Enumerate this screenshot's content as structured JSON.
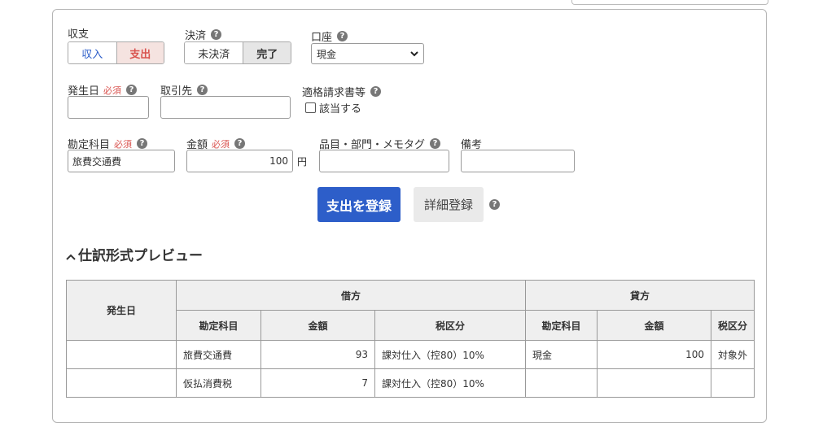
{
  "form": {
    "income_expense": {
      "label": "収支",
      "options": [
        "収入",
        "支出"
      ],
      "selected": "支出"
    },
    "settlement": {
      "label": "決済",
      "options": [
        "未決済",
        "完了"
      ],
      "selected": "完了"
    },
    "account": {
      "label": "口座",
      "value": "現金"
    },
    "date": {
      "label": "発生日",
      "required": "必須",
      "value": ""
    },
    "partner": {
      "label": "取引先",
      "value": ""
    },
    "invoice": {
      "label": "適格請求書等",
      "checkbox_label": "該当する",
      "checked": false
    },
    "category": {
      "label": "勘定科目",
      "required": "必須",
      "value": "旅費交通費"
    },
    "amount": {
      "label": "金額",
      "required": "必須",
      "value": "100",
      "unit": "円"
    },
    "item_tag": {
      "label": "品目・部門・メモタグ",
      "value": ""
    },
    "note": {
      "label": "備考",
      "value": ""
    }
  },
  "actions": {
    "register": "支出を登録",
    "detail": "詳細登録"
  },
  "preview": {
    "title": "仕訳形式プレビュー",
    "headers": {
      "date": "発生日",
      "debit": "借方",
      "credit": "貸方",
      "account": "勘定科目",
      "amount": "金額",
      "tax": "税区分"
    },
    "rows": [
      {
        "date": "",
        "debit_account": "旅費交通費",
        "debit_amount": "93",
        "debit_tax": "課対仕入（控80）10%",
        "credit_account": "現金",
        "credit_amount": "100",
        "credit_tax": "対象外"
      },
      {
        "date": "",
        "debit_account": "仮払消費税",
        "debit_amount": "7",
        "debit_tax": "課対仕入（控80）10%",
        "credit_account": "",
        "credit_amount": "",
        "credit_tax": ""
      }
    ]
  },
  "colors": {
    "primary": "#2d5ec9",
    "income": "#2d5ec9",
    "expense": "#d9534f",
    "required": "#d9534f"
  }
}
